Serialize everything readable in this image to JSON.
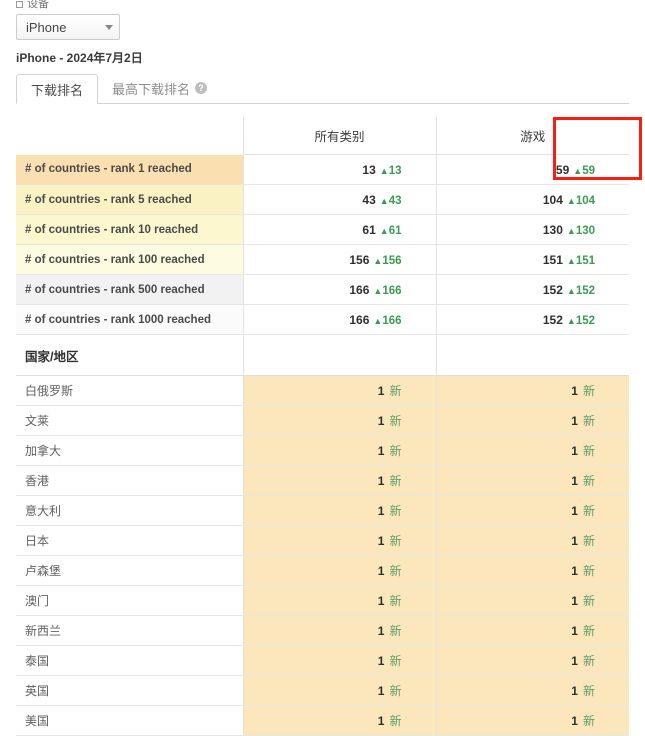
{
  "filter": {
    "label": "设备",
    "checkbox_icon": "square-icon",
    "selected": "iPhone",
    "caret_icon": "chevron-down-icon"
  },
  "subtitle": "iPhone - 2024年7月2日",
  "tabs": [
    {
      "label": "下载排名",
      "active": true
    },
    {
      "label": "最高下载排名",
      "active": false,
      "help_icon": "help-circle-icon",
      "help_glyph": "?"
    }
  ],
  "table": {
    "columns": [
      "",
      "所有类别",
      "游戏"
    ],
    "rank_rows": [
      {
        "label": "# of countries - rank 1 reached",
        "all": "13",
        "all_delta": "13",
        "games": "59",
        "games_delta": "59"
      },
      {
        "label": "# of countries - rank 5 reached",
        "all": "43",
        "all_delta": "43",
        "games": "104",
        "games_delta": "104"
      },
      {
        "label": "# of countries - rank 10 reached",
        "all": "61",
        "all_delta": "61",
        "games": "130",
        "games_delta": "130"
      },
      {
        "label": "# of countries - rank 100 reached",
        "all": "156",
        "all_delta": "156",
        "games": "151",
        "games_delta": "151"
      },
      {
        "label": "# of countries - rank 500 reached",
        "all": "166",
        "all_delta": "166",
        "games": "152",
        "games_delta": "152"
      },
      {
        "label": "# of countries - rank 1000 reached",
        "all": "166",
        "all_delta": "166",
        "games": "152",
        "games_delta": "152"
      }
    ],
    "country_header": "国家/地区",
    "country_rows": [
      {
        "label": "白俄罗斯",
        "all": "1",
        "all_tag": "新",
        "games": "1",
        "games_tag": "新"
      },
      {
        "label": "文莱",
        "all": "1",
        "all_tag": "新",
        "games": "1",
        "games_tag": "新"
      },
      {
        "label": "加拿大",
        "all": "1",
        "all_tag": "新",
        "games": "1",
        "games_tag": "新"
      },
      {
        "label": "香港",
        "all": "1",
        "all_tag": "新",
        "games": "1",
        "games_tag": "新"
      },
      {
        "label": "意大利",
        "all": "1",
        "all_tag": "新",
        "games": "1",
        "games_tag": "新"
      },
      {
        "label": "日本",
        "all": "1",
        "all_tag": "新",
        "games": "1",
        "games_tag": "新"
      },
      {
        "label": "卢森堡",
        "all": "1",
        "all_tag": "新",
        "games": "1",
        "games_tag": "新"
      },
      {
        "label": "澳门",
        "all": "1",
        "all_tag": "新",
        "games": "1",
        "games_tag": "新"
      },
      {
        "label": "新西兰",
        "all": "1",
        "all_tag": "新",
        "games": "1",
        "games_tag": "新"
      },
      {
        "label": "泰国",
        "all": "1",
        "all_tag": "新",
        "games": "1",
        "games_tag": "新"
      },
      {
        "label": "英国",
        "all": "1",
        "all_tag": "新",
        "games": "1",
        "games_tag": "新"
      },
      {
        "label": "美国",
        "all": "1",
        "all_tag": "新",
        "games": "1",
        "games_tag": "新"
      }
    ],
    "delta_triangle": "▲"
  },
  "annotation": {
    "type": "highlight-rectangle",
    "color": "#fa1e10",
    "targets": "游戏 column header and rank 1 value"
  },
  "colors": {
    "delta_green": "#3c9a54",
    "new_green": "#5d9c6b",
    "highlight_orange": "#fce7bd",
    "annotation_red": "#fa1e10"
  }
}
